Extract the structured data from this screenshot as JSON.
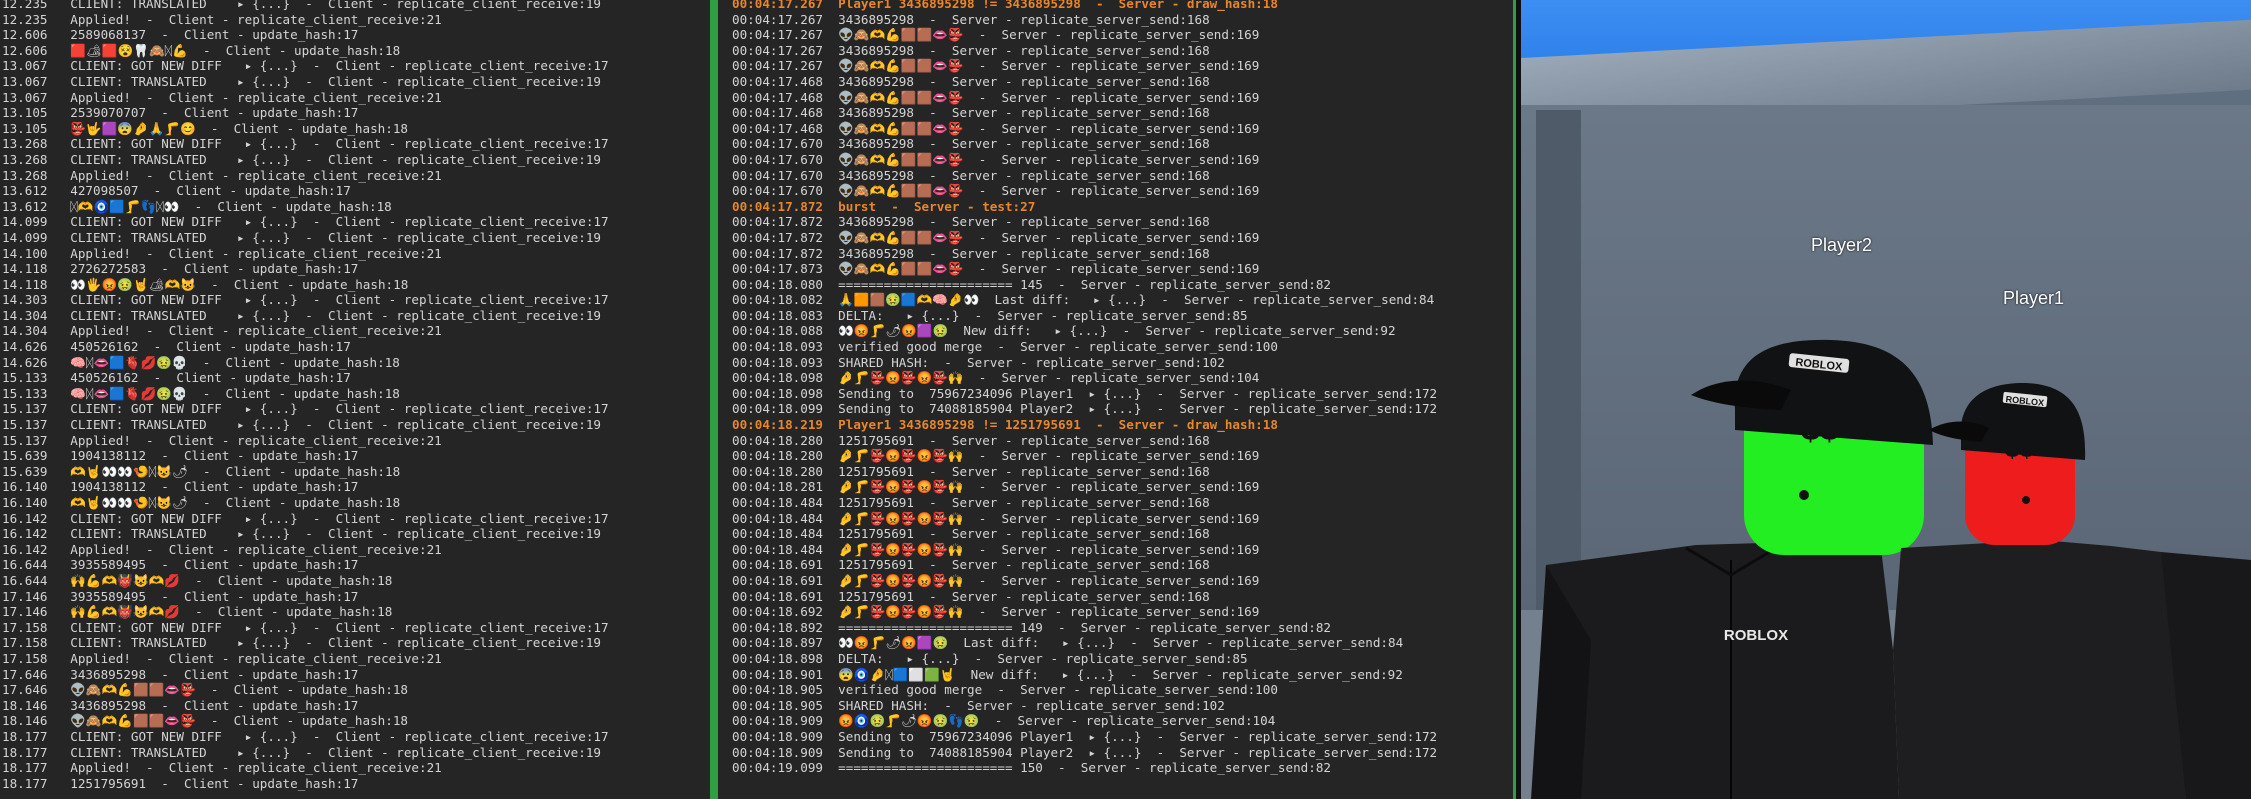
{
  "left_log": [
    "12.235   CLIENT: TRANSLATED    ▸ {...}  -  Client - replicate_client_receive:19",
    "12.235   Applied!  -  Client - replicate_client_receive:21",
    "12.606   2589068137  -  Client - update_hash:17",
    "12.606   🟥🏕🟥😵🦷🙈ᛞ💪  -  Client - update_hash:18",
    "13.067   CLIENT: GOT NEW DIFF   ▸ {...}  -  Client - replicate_client_receive:17",
    "13.067   CLIENT: TRANSLATED    ▸ {...}  -  Client - replicate_client_receive:19",
    "13.067   Applied!  -  Client - replicate_client_receive:21",
    "13.105   2539070707  -  Client - update_hash:17",
    "13.105   👺🤟🟪😨🤌🙏🦵😊  -  Client - update_hash:18",
    "13.268   CLIENT: GOT NEW DIFF   ▸ {...}  -  Client - replicate_client_receive:17",
    "13.268   CLIENT: TRANSLATED    ▸ {...}  -  Client - replicate_client_receive:19",
    "13.268   Applied!  -  Client - replicate_client_receive:21",
    "13.612   427098507  -  Client - update_hash:17",
    "13.612   ᛞ🫶🧿🟦🦵👣ᛞ👀  -  Client - update_hash:18",
    "14.099   CLIENT: GOT NEW DIFF   ▸ {...}  -  Client - replicate_client_receive:17",
    "14.099   CLIENT: TRANSLATED    ▸ {...}  -  Client - replicate_client_receive:19",
    "14.100   Applied!  -  Client - replicate_client_receive:21",
    "14.118   2726272583  -  Client - update_hash:17",
    "14.118   👀🖐😡🤢🤘🏕🫶😺  -  Client - update_hash:18",
    "14.303   CLIENT: GOT NEW DIFF   ▸ {...}  -  Client - replicate_client_receive:17",
    "14.304   CLIENT: TRANSLATED    ▸ {...}  -  Client - replicate_client_receive:19",
    "14.304   Applied!  -  Client - replicate_client_receive:21",
    "14.626   450526162  -  Client - update_hash:17",
    "14.626   🧠ᛞ👄🟦🫀💋🤢💀  -  Client - update_hash:18",
    "15.133   450526162  -  Client - update_hash:17",
    "15.133   🧠ᛞ👄🟦🫀💋🤢💀  -  Client - update_hash:18",
    "15.137   CLIENT: GOT NEW DIFF   ▸ {...}  -  Client - replicate_client_receive:17",
    "15.137   CLIENT: TRANSLATED    ▸ {...}  -  Client - replicate_client_receive:19",
    "15.137   Applied!  -  Client - replicate_client_receive:21",
    "15.639   1904138112  -  Client - update_hash:17",
    "15.639   🫶🤘👀👀🍤ᛞ😺🌶  -  Client - update_hash:18",
    "16.140   1904138112  -  Client - update_hash:17",
    "16.140   🫶🤘👀👀🍤ᛞ😺🌶  -  Client - update_hash:18",
    "16.142   CLIENT: GOT NEW DIFF   ▸ {...}  -  Client - replicate_client_receive:17",
    "16.142   CLIENT: TRANSLATED    ▸ {...}  -  Client - replicate_client_receive:19",
    "16.142   Applied!  -  Client - replicate_client_receive:21",
    "16.644   3935589495  -  Client - update_hash:17",
    "16.644   🙌💪🫶👹😺🫶💋  -  Client - update_hash:18",
    "17.146   3935589495  -  Client - update_hash:17",
    "17.146   🙌💪🫶👹😺🫶💋  -  Client - update_hash:18",
    "17.158   CLIENT: GOT NEW DIFF   ▸ {...}  -  Client - replicate_client_receive:17",
    "17.158   CLIENT: TRANSLATED    ▸ {...}  -  Client - replicate_client_receive:19",
    "17.158   Applied!  -  Client - replicate_client_receive:21",
    "17.646   3436895298  -  Client - update_hash:17",
    "17.646   👽🙈🫶💪🟫🟫👄👺  -  Client - update_hash:18",
    "18.146   3436895298  -  Client - update_hash:17",
    "18.146   👽🙈🫶💪🟫🟫👄👺  -  Client - update_hash:18",
    "18.177   CLIENT: GOT NEW DIFF   ▸ {...}  -  Client - replicate_client_receive:17",
    "18.177   CLIENT: TRANSLATED    ▸ {...}  -  Client - replicate_client_receive:19",
    "18.177   Applied!  -  Client - replicate_client_receive:21",
    "18.177   1251795691  -  Client - update_hash:17"
  ],
  "mid_log": [
    {
      "t": "00:04:17.267  Player1 3436895298 != 3436895298  -  Server - draw_hash:18",
      "hl": true
    },
    {
      "t": "00:04:17.267  3436895298  -  Server - replicate_server_send:168",
      "hl": false
    },
    {
      "t": "00:04:17.267  👽🙈🫶💪🟫🟫👄👺  -  Server - replicate_server_send:169",
      "hl": false
    },
    {
      "t": "00:04:17.267  3436895298  -  Server - replicate_server_send:168",
      "hl": false
    },
    {
      "t": "00:04:17.267  👽🙈🫶💪🟫🟫👄👺  -  Server - replicate_server_send:169",
      "hl": false
    },
    {
      "t": "00:04:17.468  3436895298  -  Server - replicate_server_send:168",
      "hl": false
    },
    {
      "t": "00:04:17.468  👽🙈🫶💪🟫🟫👄👺  -  Server - replicate_server_send:169",
      "hl": false
    },
    {
      "t": "00:04:17.468  3436895298  -  Server - replicate_server_send:168",
      "hl": false
    },
    {
      "t": "00:04:17.468  👽🙈🫶💪🟫🟫👄👺  -  Server - replicate_server_send:169",
      "hl": false
    },
    {
      "t": "00:04:17.670  3436895298  -  Server - replicate_server_send:168",
      "hl": false
    },
    {
      "t": "00:04:17.670  👽🙈🫶💪🟫🟫👄👺  -  Server - replicate_server_send:169",
      "hl": false
    },
    {
      "t": "00:04:17.670  3436895298  -  Server - replicate_server_send:168",
      "hl": false
    },
    {
      "t": "00:04:17.670  👽🙈🫶💪🟫🟫👄👺  -  Server - replicate_server_send:169",
      "hl": false
    },
    {
      "t": "00:04:17.872  burst  -  Server - test:27",
      "hl": true
    },
    {
      "t": "00:04:17.872  3436895298  -  Server - replicate_server_send:168",
      "hl": false
    },
    {
      "t": "00:04:17.872  👽🙈🫶💪🟫🟫👄👺  -  Server - replicate_server_send:169",
      "hl": false
    },
    {
      "t": "00:04:17.872  3436895298  -  Server - replicate_server_send:168",
      "hl": false
    },
    {
      "t": "00:04:17.873  👽🙈🫶💪🟫🟫👄👺  -  Server - replicate_server_send:169",
      "hl": false
    },
    {
      "t": "00:04:18.080  ======================= 145  -  Server - replicate_server_send:82",
      "hl": false
    },
    {
      "t": "00:04:18.082  🙏🟧🟫🤢🟦🫶🧠🤌👀  Last diff:   ▸ {...}  -  Server - replicate_server_send:84",
      "hl": false
    },
    {
      "t": "00:04:18.083  DELTA:   ▸ {...}  -  Server - replicate_server_send:85",
      "hl": false
    },
    {
      "t": "00:04:18.088  👀😡🦵🌶😡🟪🤢  New diff:   ▸ {...}  -  Server - replicate_server_send:92",
      "hl": false
    },
    {
      "t": "00:04:18.093  verified good merge  -  Server - replicate_server_send:100",
      "hl": false
    },
    {
      "t": "00:04:18.093  SHARED HASH:  -  Server - replicate_server_send:102",
      "hl": false
    },
    {
      "t": "00:04:18.098  🤌🦵👺😡👺😡👺🙌  -  Server - replicate_server_send:104",
      "hl": false
    },
    {
      "t": "00:04:18.098  Sending to  75967234096 Player1  ▸ {...}  -  Server - replicate_server_send:172",
      "hl": false
    },
    {
      "t": "00:04:18.099  Sending to  74088185904 Player2  ▸ {...}  -  Server - replicate_server_send:172",
      "hl": false
    },
    {
      "t": "00:04:18.219  Player1 3436895298 != 1251795691  -  Server - draw_hash:18",
      "hl": true
    },
    {
      "t": "00:04:18.280  1251795691  -  Server - replicate_server_send:168",
      "hl": false
    },
    {
      "t": "00:04:18.280  🤌🦵👺😡👺😡👺🙌  -  Server - replicate_server_send:169",
      "hl": false
    },
    {
      "t": "00:04:18.280  1251795691  -  Server - replicate_server_send:168",
      "hl": false
    },
    {
      "t": "00:04:18.281  🤌🦵👺😡👺😡👺🙌  -  Server - replicate_server_send:169",
      "hl": false
    },
    {
      "t": "00:04:18.484  1251795691  -  Server - replicate_server_send:168",
      "hl": false
    },
    {
      "t": "00:04:18.484  🤌🦵👺😡👺😡👺🙌  -  Server - replicate_server_send:169",
      "hl": false
    },
    {
      "t": "00:04:18.484  1251795691  -  Server - replicate_server_send:168",
      "hl": false
    },
    {
      "t": "00:04:18.484  🤌🦵👺😡👺😡👺🙌  -  Server - replicate_server_send:169",
      "hl": false
    },
    {
      "t": "00:04:18.691  1251795691  -  Server - replicate_server_send:168",
      "hl": false
    },
    {
      "t": "00:04:18.691  🤌🦵👺😡👺😡👺🙌  -  Server - replicate_server_send:169",
      "hl": false
    },
    {
      "t": "00:04:18.691  1251795691  -  Server - replicate_server_send:168",
      "hl": false
    },
    {
      "t": "00:04:18.692  🤌🦵👺😡👺😡👺🙌  -  Server - replicate_server_send:169",
      "hl": false
    },
    {
      "t": "00:04:18.892  ======================= 149  -  Server - replicate_server_send:82",
      "hl": false
    },
    {
      "t": "00:04:18.897  👀😡🦵🌶😡🟪🤢  Last diff:   ▸ {...}  -  Server - replicate_server_send:84",
      "hl": false
    },
    {
      "t": "00:04:18.898  DELTA:   ▸ {...}  -  Server - replicate_server_send:85",
      "hl": false
    },
    {
      "t": "00:04:18.901  😨🧿🤌ᛞ🟦⬜🟩🤘  New diff:   ▸ {...}  -  Server - replicate_server_send:92",
      "hl": false
    },
    {
      "t": "00:04:18.905  verified good merge  -  Server - replicate_server_send:100",
      "hl": false
    },
    {
      "t": "00:04:18.905  SHARED HASH:  -  Server - replicate_server_send:102",
      "hl": false
    },
    {
      "t": "00:04:18.909  😡🧿🤢🦵🌶😡🤢👣🤢  -  Server - replicate_server_send:104",
      "hl": false
    },
    {
      "t": "00:04:18.909  Sending to  75967234096 Player1  ▸ {...}  -  Server - replicate_server_send:172",
      "hl": false
    },
    {
      "t": "00:04:18.909  Sending to  74088185904 Player2  ▸ {...}  -  Server - replicate_server_send:172",
      "hl": false
    },
    {
      "t": "00:04:19.099  ======================= 150  -  Server - replicate_server_send:82",
      "hl": false
    }
  ],
  "game": {
    "player2_name": "Player2",
    "player1_name": "Player1",
    "player2_face": "$$",
    "player1_face": "$$",
    "hat_brand": "ROBLOX",
    "shirt_brand": "ROBLOX",
    "player2_color": "#22ee22",
    "player1_color": "#ee1c1c"
  }
}
